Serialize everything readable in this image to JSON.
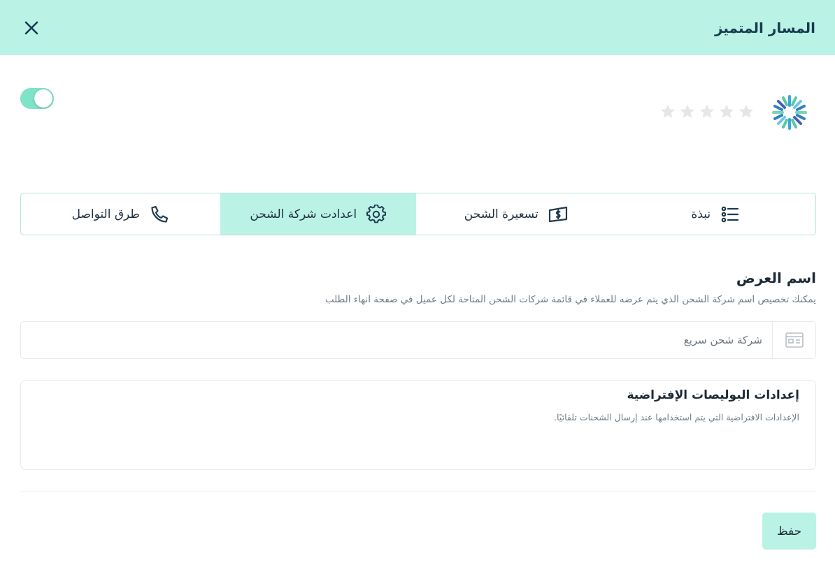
{
  "header": {
    "title": "المسار المتميز",
    "close_icon": "close-icon"
  },
  "provider": {
    "logo_icon": "snowflake-logo-icon",
    "rating": {
      "value": 0,
      "max": 5
    },
    "enabled": true
  },
  "tabs": [
    {
      "label": "نبذة",
      "icon": "list-icon",
      "active": false
    },
    {
      "label": "تسعيرة الشحن",
      "icon": "money-icon",
      "active": false
    },
    {
      "label": "اعدادت شركة الشحن",
      "icon": "gear-icon",
      "active": true
    },
    {
      "label": "طرق التواصل",
      "icon": "phone-icon",
      "active": false
    }
  ],
  "display_name": {
    "title": "اسم العرض",
    "description": "يمكنك تخصيص اسم شركة الشحن الذي يتم عرضه للعملاء في قائمة شركات الشحن المتاحة لكل عميل في صفحة انهاء الطلب",
    "input_value": "",
    "placeholder": "شركة شحن سريع",
    "icon": "id-card-icon"
  },
  "default_policies": {
    "title": "إعدادات البوليصات الإفتراضية",
    "description": "الإعدادات الافتراضية التي يتم استخدامها عند إرسال الشحنات تلقائيًا."
  },
  "actions": {
    "save_label": "حفظ"
  },
  "colors": {
    "accent_light": "#baf3e5",
    "toggle_on": "#7ee3c7",
    "star_empty": "#e6e6e6",
    "text_dark": "#173b4f"
  }
}
